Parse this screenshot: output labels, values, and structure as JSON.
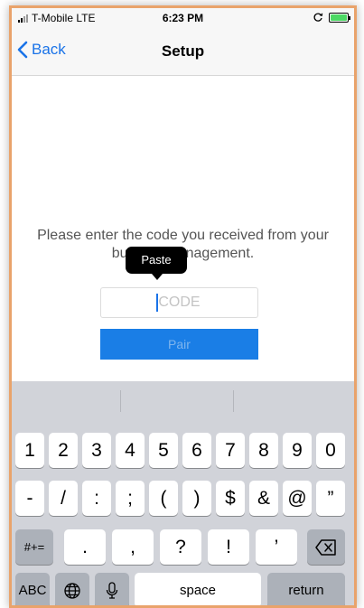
{
  "status_bar": {
    "carrier": "T-Mobile LTE",
    "time": "6:23 PM",
    "battery_color": "#4cd964"
  },
  "nav": {
    "back_label": "Back",
    "title": "Setup"
  },
  "main": {
    "instruction": "Please enter the code you received from your building management.",
    "paste_label": "Paste",
    "code_placeholder": "CODE",
    "pair_label": "Pair"
  },
  "keyboard": {
    "row1": [
      "1",
      "2",
      "3",
      "4",
      "5",
      "6",
      "7",
      "8",
      "9",
      "0"
    ],
    "row2": [
      "-",
      "/",
      ":",
      ";",
      "(",
      ")",
      "$",
      "&",
      "@",
      "”"
    ],
    "row3_mode": "#+=",
    "row3": [
      ".",
      ",",
      "?",
      "!",
      "’"
    ],
    "abc_label": "ABC",
    "space_label": "space",
    "return_label": "return"
  },
  "colors": {
    "accent": "#1a73e8",
    "pair_button": "#1a7ee6",
    "keyboard_bg": "#d1d3d9",
    "frame_border": "#e9a36b"
  },
  "icons": {
    "back": "chevron-left-icon",
    "rotation_lock": "rotation-lock-icon",
    "globe": "globe-icon",
    "microphone": "microphone-icon",
    "backspace": "backspace-icon"
  }
}
